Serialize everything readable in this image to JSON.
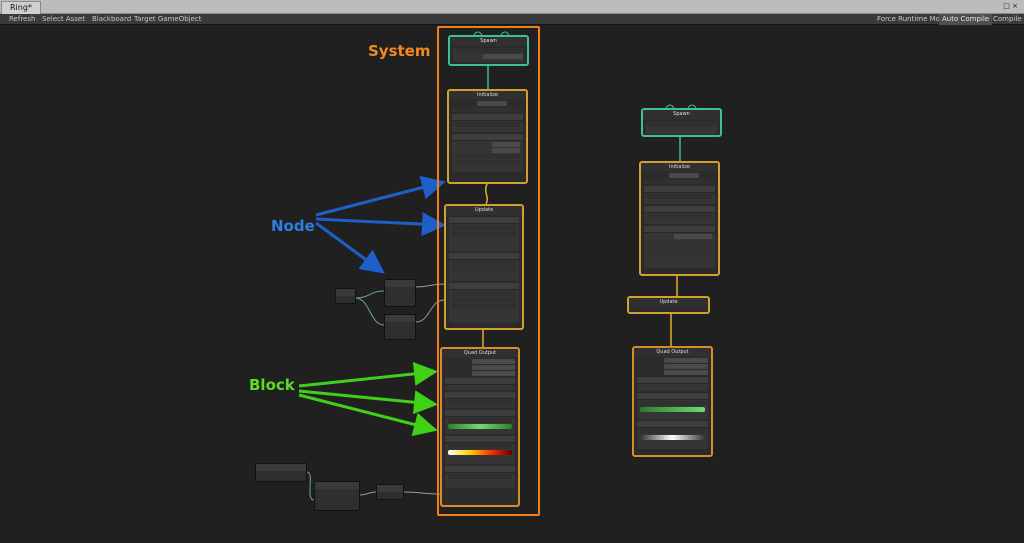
{
  "window": {
    "tab_title": "Ring*",
    "controls": "□ ×"
  },
  "toolbar": {
    "refresh": "Refresh",
    "select_asset": "Select Asset",
    "blackboard": "Blackboard",
    "target_gameobject": "Target GameObject",
    "force_runtime_mode": "Force Runtime Mode",
    "auto_compile": "Auto Compile",
    "compile": "Compile"
  },
  "graph": {
    "left_system": {
      "spawn_title": "Spawn",
      "init_title": "Initialize",
      "update_title": "Update",
      "output_title": "Quad Output"
    },
    "right_system": {
      "spawn_title": "Spawn",
      "init_title": "Initialize",
      "update_title": "Update",
      "output_title": "Quad Output"
    }
  },
  "annotations": {
    "system": "System",
    "node": "Node",
    "block": "Block"
  },
  "colors": {
    "spawn_border": "#3fbf98",
    "context_border": "#d2a030",
    "output_border": "#d98a2b",
    "system_frame": "#f07f1a",
    "anno_system": "#f28a1f",
    "anno_node": "#2f7de0",
    "anno_block": "#5fdc22",
    "arrow_node": "#1f5fc9",
    "arrow_block": "#3fd017"
  }
}
